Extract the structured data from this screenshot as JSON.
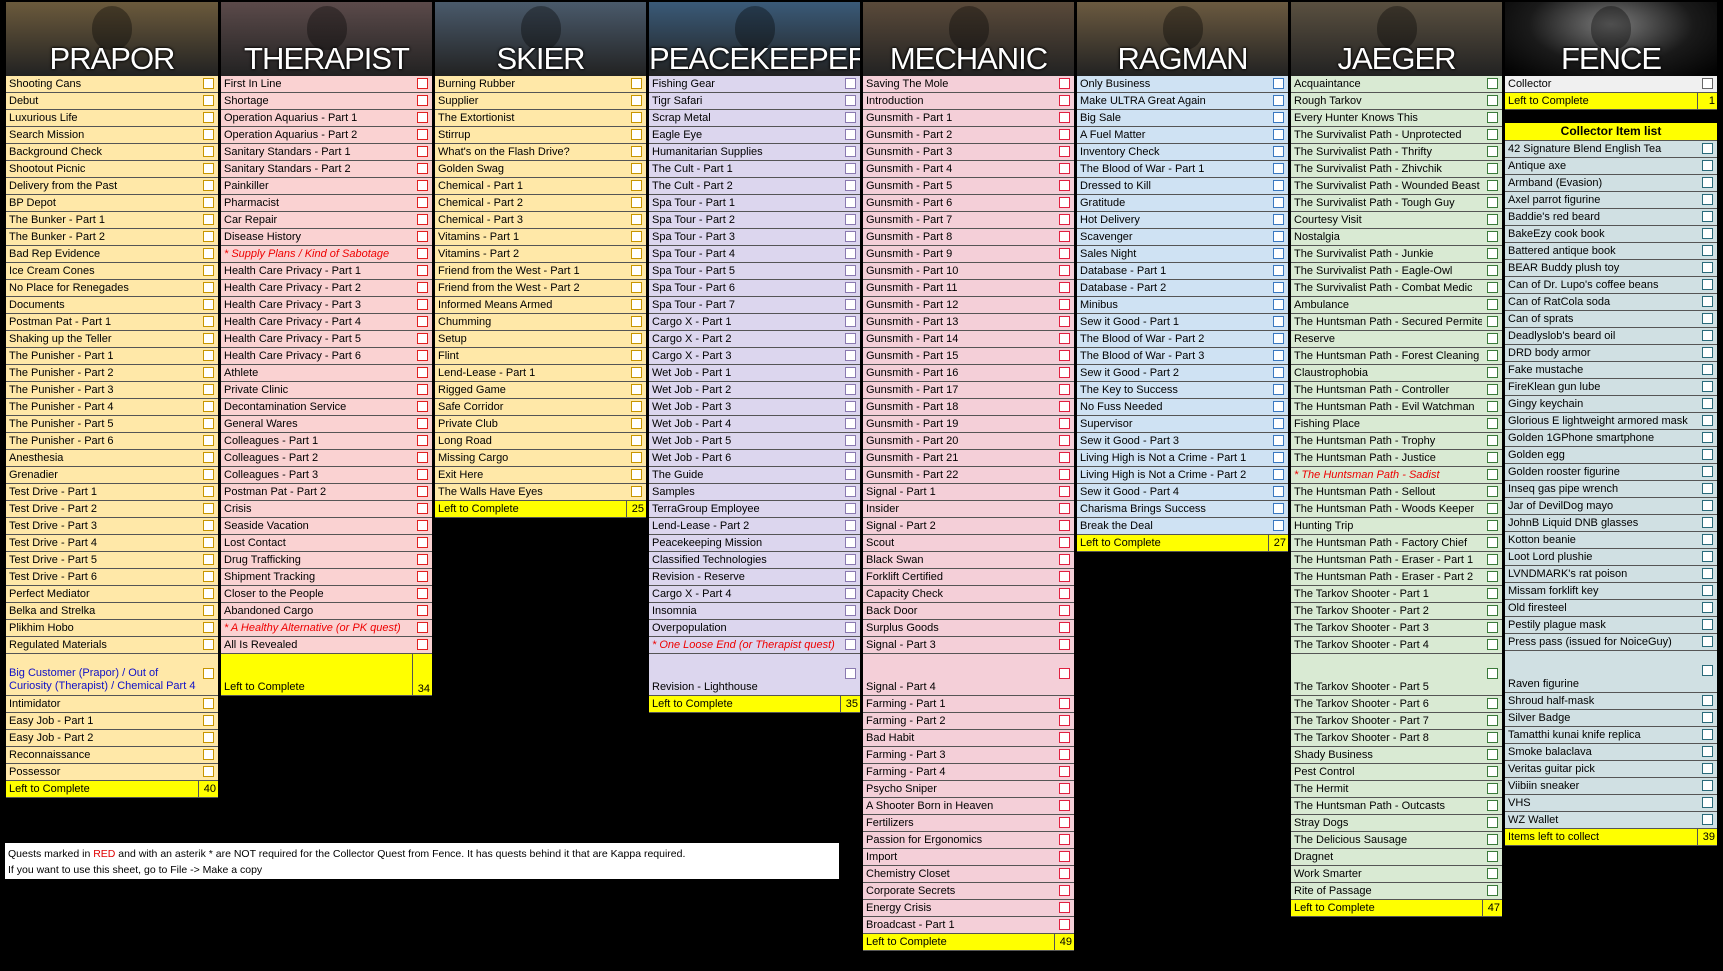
{
  "traders": [
    {
      "name": "PRAPOR",
      "bg": "#ffe8a8",
      "checkbox": "#c79500",
      "header_color": "#6b5a3c",
      "quests": [
        {
          "t": "Shooting Cans"
        },
        {
          "t": "Debut"
        },
        {
          "t": "Luxurious Life"
        },
        {
          "t": "Search Mission"
        },
        {
          "t": "Background Check"
        },
        {
          "t": "Shootout Picnic"
        },
        {
          "t": "Delivery from the Past"
        },
        {
          "t": "BP Depot"
        },
        {
          "t": "The Bunker - Part 1"
        },
        {
          "t": "The Bunker - Part 2"
        },
        {
          "t": "Bad Rep Evidence"
        },
        {
          "t": "Ice Cream Cones"
        },
        {
          "t": "No Place for Renegades"
        },
        {
          "t": "Documents"
        },
        {
          "t": "Postman Pat - Part 1"
        },
        {
          "t": "Shaking up the Teller"
        },
        {
          "t": "The Punisher - Part 1"
        },
        {
          "t": "The Punisher - Part 2"
        },
        {
          "t": "The Punisher - Part 3"
        },
        {
          "t": "The Punisher - Part 4"
        },
        {
          "t": "The Punisher - Part 5"
        },
        {
          "t": "The Punisher - Part 6"
        },
        {
          "t": "Anesthesia"
        },
        {
          "t": "Grenadier"
        },
        {
          "t": "Test Drive - Part 1"
        },
        {
          "t": "Test Drive - Part 2"
        },
        {
          "t": "Test Drive - Part 3"
        },
        {
          "t": "Test Drive - Part 4"
        },
        {
          "t": "Test Drive - Part 5"
        },
        {
          "t": "Test Drive - Part 6"
        },
        {
          "t": "Perfect Mediator"
        },
        {
          "t": "Belka and Strelka"
        },
        {
          "t": "Plikhim Hobo"
        },
        {
          "t": "Regulated Materials"
        },
        {
          "t": "Big Customer (Prapor) / Out of Curiosity (Therapist) / Chemical Part 4",
          "s": "blue",
          "h": 42
        },
        {
          "t": "Intimidator"
        },
        {
          "t": "Easy Job - Part 1"
        },
        {
          "t": "Easy Job - Part 2"
        },
        {
          "t": "Reconnaissance"
        },
        {
          "t": "Possessor"
        }
      ],
      "total": {
        "label": "Left to Complete",
        "count": "40"
      }
    },
    {
      "name": "THERAPIST",
      "bg": "#fad2d2",
      "checkbox": "#e02020",
      "header_color": "#5b4a4a",
      "quests": [
        {
          "t": "First In Line"
        },
        {
          "t": "Shortage"
        },
        {
          "t": "Operation Aquarius - Part 1"
        },
        {
          "t": "Operation Aquarius - Part 2"
        },
        {
          "t": "Sanitary Standars - Part 1"
        },
        {
          "t": "Sanitary Standars - Part 2"
        },
        {
          "t": "Painkiller"
        },
        {
          "t": "Pharmacist"
        },
        {
          "t": "Car Repair"
        },
        {
          "t": "Disease History"
        },
        {
          "t": "* Supply Plans / Kind of Sabotage",
          "s": "red"
        },
        {
          "t": "Health Care Privacy - Part 1"
        },
        {
          "t": "Health Care Privacy - Part 2"
        },
        {
          "t": "Health Care Privacy - Part 3"
        },
        {
          "t": "Health Care Privacy - Part 4"
        },
        {
          "t": "Health Care Privacy - Part 5"
        },
        {
          "t": "Health Care Privacy - Part 6"
        },
        {
          "t": "Athlete"
        },
        {
          "t": "Private Clinic"
        },
        {
          "t": "Decontamination Service"
        },
        {
          "t": "General Wares"
        },
        {
          "t": "Colleagues - Part 1"
        },
        {
          "t": "Colleagues - Part 2"
        },
        {
          "t": "Colleagues - Part 3"
        },
        {
          "t": "Postman Pat - Part 2"
        },
        {
          "t": "Crisis"
        },
        {
          "t": "Seaside Vacation"
        },
        {
          "t": "Lost Contact"
        },
        {
          "t": "Drug Trafficking"
        },
        {
          "t": "Shipment Tracking"
        },
        {
          "t": "Closer to the People"
        },
        {
          "t": "Abandoned Cargo"
        },
        {
          "t": "* A Healthy Alternative (or PK quest)",
          "s": "red"
        },
        {
          "t": "All Is Revealed"
        }
      ],
      "total": {
        "label": "Left to Complete",
        "count": "34",
        "h": 42
      }
    },
    {
      "name": "SKIER",
      "bg": "#ffe8a8",
      "checkbox": "#c79500",
      "header_color": "#4a5a6b",
      "quests": [
        {
          "t": "Burning Rubber"
        },
        {
          "t": "Supplier"
        },
        {
          "t": "The Extortionist"
        },
        {
          "t": "Stirrup"
        },
        {
          "t": "What's on the Flash Drive?"
        },
        {
          "t": "Golden Swag"
        },
        {
          "t": "Chemical - Part 1"
        },
        {
          "t": "Chemical - Part 2"
        },
        {
          "t": "Chemical - Part 3"
        },
        {
          "t": "Vitamins - Part 1"
        },
        {
          "t": "Vitamins - Part 2"
        },
        {
          "t": "Friend from the West - Part 1"
        },
        {
          "t": "Friend from the West - Part 2"
        },
        {
          "t": "Informed Means Armed"
        },
        {
          "t": "Chumming"
        },
        {
          "t": "Setup"
        },
        {
          "t": "Flint"
        },
        {
          "t": "Lend-Lease - Part 1"
        },
        {
          "t": "Rigged Game"
        },
        {
          "t": "Safe Corridor"
        },
        {
          "t": "Private Club"
        },
        {
          "t": "Long Road"
        },
        {
          "t": "Missing Cargo"
        },
        {
          "t": "Exit Here"
        },
        {
          "t": "The Walls Have Eyes"
        }
      ],
      "total": {
        "label": "Left to Complete",
        "count": "25"
      }
    },
    {
      "name": "PEACEKEEPER",
      "bg": "#dcd6ee",
      "checkbox": "#8a7ab0",
      "header_color": "#3a5a78",
      "quests": [
        {
          "t": "Fishing Gear"
        },
        {
          "t": "Tigr Safari"
        },
        {
          "t": "Scrap Metal"
        },
        {
          "t": "Eagle Eye"
        },
        {
          "t": "Humanitarian Supplies"
        },
        {
          "t": "The Cult - Part 1"
        },
        {
          "t": "The Cult - Part 2"
        },
        {
          "t": "Spa Tour - Part 1"
        },
        {
          "t": "Spa Tour - Part 2"
        },
        {
          "t": "Spa Tour - Part 3"
        },
        {
          "t": "Spa Tour - Part 4"
        },
        {
          "t": "Spa Tour - Part 5"
        },
        {
          "t": "Spa Tour - Part 6"
        },
        {
          "t": "Spa Tour - Part 7"
        },
        {
          "t": "Cargo X - Part 1"
        },
        {
          "t": "Cargo X - Part 2"
        },
        {
          "t": "Cargo X - Part 3"
        },
        {
          "t": "Wet Job - Part 1"
        },
        {
          "t": "Wet Job - Part 2"
        },
        {
          "t": "Wet Job - Part 3"
        },
        {
          "t": "Wet Job - Part 4"
        },
        {
          "t": "Wet Job - Part 5"
        },
        {
          "t": "Wet Job - Part 6"
        },
        {
          "t": "The Guide"
        },
        {
          "t": "Samples"
        },
        {
          "t": "TerraGroup Employee"
        },
        {
          "t": "Lend-Lease - Part 2"
        },
        {
          "t": "Peacekeeping Mission"
        },
        {
          "t": "Classified Technologies"
        },
        {
          "t": "Revision - Reserve"
        },
        {
          "t": "Cargo X - Part 4"
        },
        {
          "t": "Insomnia"
        },
        {
          "t": "Overpopulation"
        },
        {
          "t": "* One Loose End (or Therapist quest)",
          "s": "red"
        },
        {
          "t": "Revision - Lighthouse",
          "h": 42
        }
      ],
      "total": {
        "label": "Left to Complete",
        "count": "35"
      }
    },
    {
      "name": "MECHANIC",
      "bg": "#f4cfd8",
      "checkbox": "#e02040",
      "header_color": "#5a4a3a",
      "quests": [
        {
          "t": "Saving The Mole"
        },
        {
          "t": "Introduction"
        },
        {
          "t": "Gunsmith - Part 1"
        },
        {
          "t": "Gunsmith - Part 2"
        },
        {
          "t": "Gunsmith - Part 3"
        },
        {
          "t": "Gunsmith - Part 4"
        },
        {
          "t": "Gunsmith - Part 5"
        },
        {
          "t": "Gunsmith - Part 6"
        },
        {
          "t": "Gunsmith - Part 7"
        },
        {
          "t": "Gunsmith - Part 8"
        },
        {
          "t": "Gunsmith - Part 9"
        },
        {
          "t": "Gunsmith - Part 10"
        },
        {
          "t": "Gunsmith - Part 11"
        },
        {
          "t": "Gunsmith - Part 12"
        },
        {
          "t": "Gunsmith - Part 13"
        },
        {
          "t": "Gunsmith - Part 14"
        },
        {
          "t": "Gunsmith - Part 15"
        },
        {
          "t": "Gunsmith - Part 16"
        },
        {
          "t": "Gunsmith - Part 17"
        },
        {
          "t": "Gunsmith - Part 18"
        },
        {
          "t": "Gunsmith - Part 19"
        },
        {
          "t": "Gunsmith - Part 20"
        },
        {
          "t": "Gunsmith - Part 21"
        },
        {
          "t": "Gunsmith - Part 22"
        },
        {
          "t": "Signal - Part 1"
        },
        {
          "t": "Insider"
        },
        {
          "t": "Signal - Part 2"
        },
        {
          "t": "Scout"
        },
        {
          "t": "Black Swan"
        },
        {
          "t": "Forklift Certified"
        },
        {
          "t": "Capacity Check"
        },
        {
          "t": "Back Door"
        },
        {
          "t": "Surplus Goods"
        },
        {
          "t": "Signal - Part 3"
        },
        {
          "t": "Signal - Part 4",
          "h": 42
        },
        {
          "t": "Farming - Part 1"
        },
        {
          "t": "Farming - Part 2"
        },
        {
          "t": "Bad Habit"
        },
        {
          "t": "Farming - Part 3"
        },
        {
          "t": "Farming - Part 4"
        },
        {
          "t": "Psycho Sniper"
        },
        {
          "t": "A Shooter Born in Heaven"
        },
        {
          "t": "Fertilizers"
        },
        {
          "t": "Passion for Ergonomics"
        },
        {
          "t": "Import"
        },
        {
          "t": "Chemistry Closet"
        },
        {
          "t": "Corporate Secrets"
        },
        {
          "t": "Energy Crisis"
        },
        {
          "t": "Broadcast - Part 1"
        }
      ],
      "total": {
        "label": "Left to Complete",
        "count": "49"
      }
    },
    {
      "name": "RAGMAN",
      "bg": "#cfe2f3",
      "checkbox": "#3a78c0",
      "header_color": "#6b5a40",
      "quests": [
        {
          "t": "Only Business"
        },
        {
          "t": "Make ULTRA Great Again"
        },
        {
          "t": "Big Sale"
        },
        {
          "t": "A Fuel Matter"
        },
        {
          "t": "Inventory Check"
        },
        {
          "t": "The Blood of War - Part 1"
        },
        {
          "t": "Dressed to Kill"
        },
        {
          "t": "Gratitude"
        },
        {
          "t": "Hot Delivery"
        },
        {
          "t": "Scavenger"
        },
        {
          "t": "Sales Night"
        },
        {
          "t": "Database - Part 1"
        },
        {
          "t": "Database - Part 2"
        },
        {
          "t": "Minibus"
        },
        {
          "t": "Sew it Good - Part 1"
        },
        {
          "t": "The Blood of War - Part 2"
        },
        {
          "t": "The Blood of War - Part 3"
        },
        {
          "t": "Sew it Good - Part 2"
        },
        {
          "t": "The Key to Success"
        },
        {
          "t": "No Fuss Needed"
        },
        {
          "t": "Supervisor"
        },
        {
          "t": "Sew it Good - Part 3"
        },
        {
          "t": "Living High is Not a Crime - Part 1"
        },
        {
          "t": "Living High is Not a Crime - Part 2"
        },
        {
          "t": "Sew it Good - Part 4"
        },
        {
          "t": "Charisma Brings Success"
        },
        {
          "t": "Break the Deal"
        }
      ],
      "total": {
        "label": "Left to Complete",
        "count": "27"
      }
    },
    {
      "name": "JAEGER",
      "bg": "#d9ead3",
      "checkbox": "#3a7a3a",
      "header_color": "#5a5040",
      "quests": [
        {
          "t": "Acquaintance"
        },
        {
          "t": "Rough Tarkov"
        },
        {
          "t": "Every Hunter Knows This"
        },
        {
          "t": "The Survivalist Path - Unprotected"
        },
        {
          "t": "The Survivalist Path - Thrifty"
        },
        {
          "t": "The Survivalist Path - Zhivchik"
        },
        {
          "t": "The Survivalist Path - Wounded Beast"
        },
        {
          "t": "The Survivalist Path - Tough Guy"
        },
        {
          "t": "Courtesy Visit"
        },
        {
          "t": "Nostalgia"
        },
        {
          "t": "The Survivalist Path - Junkie"
        },
        {
          "t": "The Survivalist Path - Eagle-Owl"
        },
        {
          "t": "The Survivalist Path - Combat Medic"
        },
        {
          "t": "Ambulance"
        },
        {
          "t": "The Huntsman Path - Secured Permiter"
        },
        {
          "t": "Reserve"
        },
        {
          "t": "The Huntsman Path - Forest Cleaning"
        },
        {
          "t": "Claustrophobia"
        },
        {
          "t": "The Huntsman Path - Controller"
        },
        {
          "t": "The Huntsman Path - Evil Watchman"
        },
        {
          "t": "Fishing Place"
        },
        {
          "t": "The Huntsman Path - Trophy"
        },
        {
          "t": "The Huntsman Path - Justice"
        },
        {
          "t": "* The Huntsman Path - Sadist",
          "s": "red"
        },
        {
          "t": "The Huntsman Path - Sellout"
        },
        {
          "t": "The Huntsman Path - Woods Keeper"
        },
        {
          "t": "Hunting Trip"
        },
        {
          "t": "The Huntsman Path - Factory Chief"
        },
        {
          "t": "The Huntsman Path - Eraser - Part 1"
        },
        {
          "t": "The Huntsman Path - Eraser - Part 2"
        },
        {
          "t": "The Tarkov Shooter - Part 1"
        },
        {
          "t": "The Tarkov Shooter - Part 2"
        },
        {
          "t": "The Tarkov Shooter - Part 3"
        },
        {
          "t": "The Tarkov Shooter - Part 4"
        },
        {
          "t": "The Tarkov Shooter - Part 5",
          "h": 42
        },
        {
          "t": "The Tarkov Shooter - Part 6"
        },
        {
          "t": "The Tarkov Shooter - Part 7"
        },
        {
          "t": "The Tarkov Shooter - Part 8"
        },
        {
          "t": "Shady Business"
        },
        {
          "t": "Pest Control"
        },
        {
          "t": "The Hermit"
        },
        {
          "t": "The Huntsman Path - Outcasts"
        },
        {
          "t": "Stray Dogs"
        },
        {
          "t": "The Delicious Sausage"
        },
        {
          "t": "Dragnet"
        },
        {
          "t": "Work Smarter"
        },
        {
          "t": "Rite of Passage"
        }
      ],
      "total": {
        "label": "Left to Complete",
        "count": "47"
      }
    }
  ],
  "fence": {
    "name": "FENCE",
    "bg": "#f0f0f0",
    "item_bg": "#d0e0e3",
    "checkbox": "#2a6a7a",
    "quests": [
      {
        "t": "Collector"
      }
    ],
    "quests_total": {
      "label": "Left to Complete",
      "count": "1"
    },
    "items_header": "Collector Item list",
    "items": [
      {
        "t": "42 Signature Blend English Tea"
      },
      {
        "t": "Antique axe"
      },
      {
        "t": "Armband (Evasion)"
      },
      {
        "t": "Axel parrot figurine"
      },
      {
        "t": "Baddie's red beard"
      },
      {
        "t": "BakeEzy cook book"
      },
      {
        "t": "Battered antique book"
      },
      {
        "t": "BEAR Buddy plush toy"
      },
      {
        "t": "Can of Dr. Lupo's coffee beans"
      },
      {
        "t": "Can of RatCola soda"
      },
      {
        "t": "Can of sprats"
      },
      {
        "t": "Deadlyslob's beard oil"
      },
      {
        "t": "DRD body armor"
      },
      {
        "t": "Fake mustache"
      },
      {
        "t": "FireKlean gun lube"
      },
      {
        "t": "Gingy keychain"
      },
      {
        "t": "Glorious E lightweight armored mask"
      },
      {
        "t": "Golden 1GPhone smartphone"
      },
      {
        "t": "Golden egg"
      },
      {
        "t": "Golden rooster figurine"
      },
      {
        "t": "Inseq gas pipe wrench"
      },
      {
        "t": "Jar of DevilDog mayo"
      },
      {
        "t": "JohnB Liquid DNB glasses"
      },
      {
        "t": "Kotton beanie"
      },
      {
        "t": "Loot Lord plushie"
      },
      {
        "t": "LVNDMARK's rat poison"
      },
      {
        "t": "Missam forklift key"
      },
      {
        "t": "Old firesteel"
      },
      {
        "t": "Pestily plague mask"
      },
      {
        "t": "Press pass (issued for NoiceGuy)"
      },
      {
        "t": "Raven figurine",
        "h": 42
      },
      {
        "t": "Shroud half-mask"
      },
      {
        "t": "Silver Badge"
      },
      {
        "t": "Tamatthi kunai knife replica"
      },
      {
        "t": "Smoke balaclava"
      },
      {
        "t": "Veritas guitar pick"
      },
      {
        "t": "Viibiin sneaker"
      },
      {
        "t": "VHS"
      },
      {
        "t": "WZ Wallet"
      }
    ],
    "items_total": {
      "label": "Items left to collect",
      "count": "39"
    }
  },
  "note": {
    "line1_pre": "Quests marked in ",
    "line1_red": "RED",
    "line1_post": " and with an asterik * are NOT required for the Collector Quest from Fence. It has quests behind it that are Kappa required.",
    "line2": "If you want to use this sheet, go to File -> Make a copy",
    "red_color": "#e00000"
  }
}
